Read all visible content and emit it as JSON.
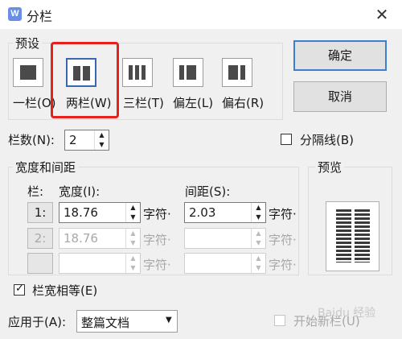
{
  "dialog": {
    "title": "分栏",
    "app_icon": "W",
    "close_glyph": "✕"
  },
  "presets": {
    "group_label": "预设",
    "items": [
      {
        "label": "一栏(O)",
        "icon": "one-column-icon"
      },
      {
        "label": "两栏(W)",
        "icon": "two-column-icon"
      },
      {
        "label": "三栏(T)",
        "icon": "three-column-icon"
      },
      {
        "label": "偏左(L)",
        "icon": "left-column-icon"
      },
      {
        "label": "偏右(R)",
        "icon": "right-column-icon"
      }
    ],
    "selected_index": 1
  },
  "buttons": {
    "ok": "确定",
    "cancel": "取消"
  },
  "columns_count": {
    "label": "栏数(N):",
    "value": "2"
  },
  "separator_line": {
    "label": "分隔线(B)",
    "checked": false
  },
  "width_spacing": {
    "group_label": "宽度和间距",
    "col_header": "栏:",
    "width_header": "宽度(I):",
    "spacing_header": "间距(S):",
    "unit": "字符·",
    "rows": [
      {
        "num": "1:",
        "width": "18.76",
        "spacing": "2.03",
        "enabled": true
      },
      {
        "num": "2:",
        "width": "18.76",
        "spacing": "",
        "enabled": false
      },
      {
        "num": "",
        "width": "",
        "spacing": "",
        "enabled": false
      }
    ]
  },
  "equal_width": {
    "label": "栏宽相等(E)",
    "checked": true
  },
  "preview": {
    "label": "预览"
  },
  "apply_to": {
    "label": "应用于(A):",
    "value": "整篇文档"
  },
  "new_column": {
    "label": "开始新栏(U)",
    "checked": false,
    "enabled": false
  },
  "watermark": "Baidu 经验"
}
